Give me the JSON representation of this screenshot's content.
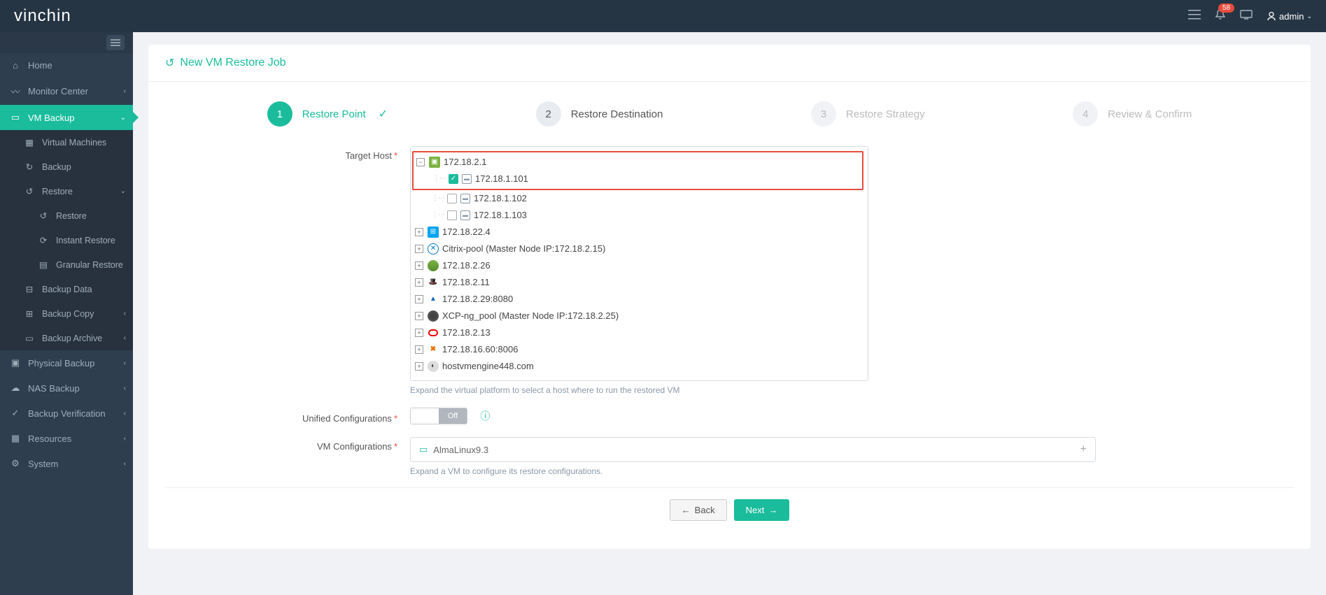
{
  "topbar": {
    "logo": "vinchin",
    "badge": "58",
    "user": "admin"
  },
  "sidebar": {
    "items": [
      {
        "label": "Home"
      },
      {
        "label": "Monitor Center"
      },
      {
        "label": "VM Backup"
      },
      {
        "label": "Virtual Machines"
      },
      {
        "label": "Backup"
      },
      {
        "label": "Restore"
      },
      {
        "label": "Restore"
      },
      {
        "label": "Instant Restore"
      },
      {
        "label": "Granular Restore"
      },
      {
        "label": "Backup Data"
      },
      {
        "label": "Backup Copy"
      },
      {
        "label": "Backup Archive"
      },
      {
        "label": "Physical Backup"
      },
      {
        "label": "NAS Backup"
      },
      {
        "label": "Backup Verification"
      },
      {
        "label": "Resources"
      },
      {
        "label": "System"
      }
    ]
  },
  "page": {
    "title": "New VM Restore Job"
  },
  "steps": [
    {
      "num": "1",
      "label": "Restore Point"
    },
    {
      "num": "2",
      "label": "Restore Destination"
    },
    {
      "num": "3",
      "label": "Restore Strategy"
    },
    {
      "num": "4",
      "label": "Review & Confirm"
    }
  ],
  "form": {
    "target_host_label": "Target Host",
    "unified_label": "Unified Configurations",
    "vm_config_label": "VM Configurations",
    "toggle_off": "Off",
    "hint1": "Expand the virtual platform to select a host where to run the restored VM",
    "hint2": "Expand a VM to configure its restore configurations."
  },
  "tree": {
    "root": "172.18.2.1",
    "children": [
      {
        "label": "172.18.1.101",
        "checked": true
      },
      {
        "label": "172.18.1.102",
        "checked": false
      },
      {
        "label": "172.18.1.103",
        "checked": false
      }
    ],
    "siblings": [
      {
        "label": "172.18.22.4",
        "icon": "win"
      },
      {
        "label": "Citrix-pool (Master Node IP:172.18.2.15)",
        "icon": "citrix"
      },
      {
        "label": "172.18.2.26",
        "icon": "green"
      },
      {
        "label": "172.18.2.11",
        "icon": "redhat"
      },
      {
        "label": "172.18.2.29:8080",
        "icon": "bluea"
      },
      {
        "label": "XCP-ng_pool (Master Node IP:172.18.2.25)",
        "icon": "xcp"
      },
      {
        "label": "172.18.2.13",
        "icon": "oracle"
      },
      {
        "label": "172.18.16.60:8006",
        "icon": "prox"
      },
      {
        "label": "hostvmengine448.com",
        "icon": "generic"
      }
    ]
  },
  "vm_config": {
    "vm_name": "AlmaLinux9.3"
  },
  "buttons": {
    "back": "Back",
    "next": "Next"
  }
}
